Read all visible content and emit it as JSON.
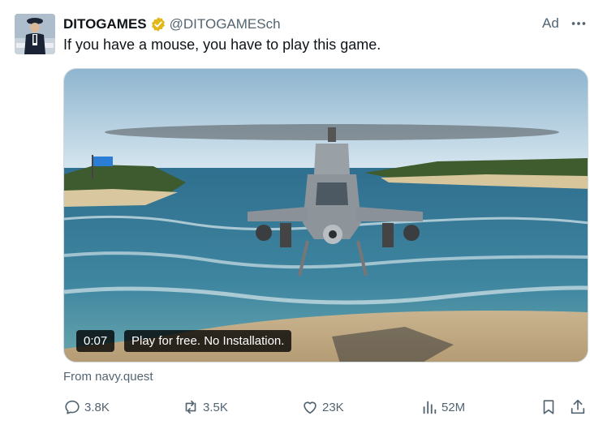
{
  "tweet": {
    "display_name": "DITOGAMES",
    "handle": "@DITOGAMESch",
    "ad_label": "Ad",
    "text": "If you have a mouse, you have to play this game.",
    "source": "From navy.quest"
  },
  "media": {
    "time": "0:07",
    "cta": "Play for free. No Installation."
  },
  "actions": {
    "replies": "3.8K",
    "reposts": "3.5K",
    "likes": "23K",
    "views": "52M"
  },
  "colors": {
    "verified": "#e2b719",
    "muted": "#536471"
  }
}
